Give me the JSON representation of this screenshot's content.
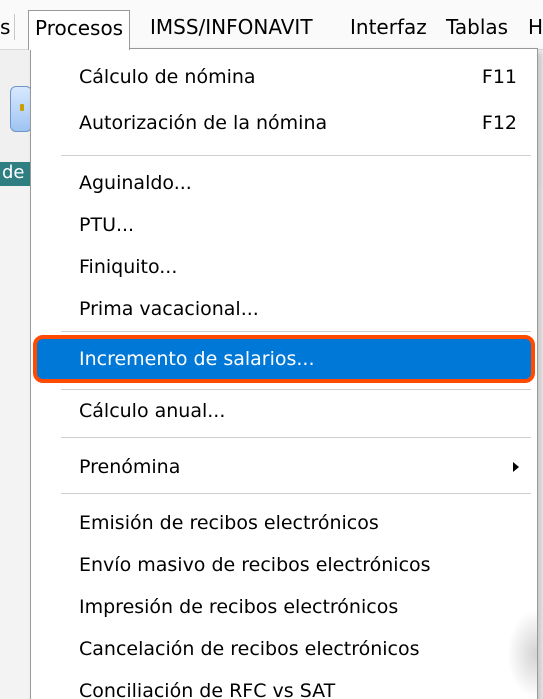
{
  "menubar": {
    "items": [
      {
        "label": "s",
        "open": false
      },
      {
        "label": "Procesos",
        "open": true
      },
      {
        "label": "IMSS/INFONAVIT",
        "open": false
      },
      {
        "label": "Interfaz",
        "open": false
      },
      {
        "label": "Tablas",
        "open": false
      },
      {
        "label": "H",
        "open": false
      }
    ]
  },
  "background": {
    "strip_text": "de"
  },
  "menu": {
    "items": [
      {
        "label": "Cálculo de nómina",
        "shortcut": "F11"
      },
      {
        "label": "Autorización de la nómina",
        "shortcut": "F12"
      },
      {
        "label": "Aguinaldo..."
      },
      {
        "label": "PTU..."
      },
      {
        "label": "Finiquito..."
      },
      {
        "label": "Prima vacacional..."
      },
      {
        "label": "Incremento de salarios...",
        "highlighted": true
      },
      {
        "label": "Cálculo anual..."
      },
      {
        "label": "Prenómina",
        "submenu": true
      },
      {
        "label": "Emisión de recibos electrónicos"
      },
      {
        "label": "Envío masivo de recibos electrónicos"
      },
      {
        "label": "Impresión de recibos electrónicos"
      },
      {
        "label": "Cancelación de recibos electrónicos"
      },
      {
        "label": "Conciliación de RFC vs SAT"
      }
    ]
  },
  "colors": {
    "highlight": "#0078d7",
    "annotation_ring": "#ff4a00",
    "teal_strip": "#2f7f82"
  }
}
